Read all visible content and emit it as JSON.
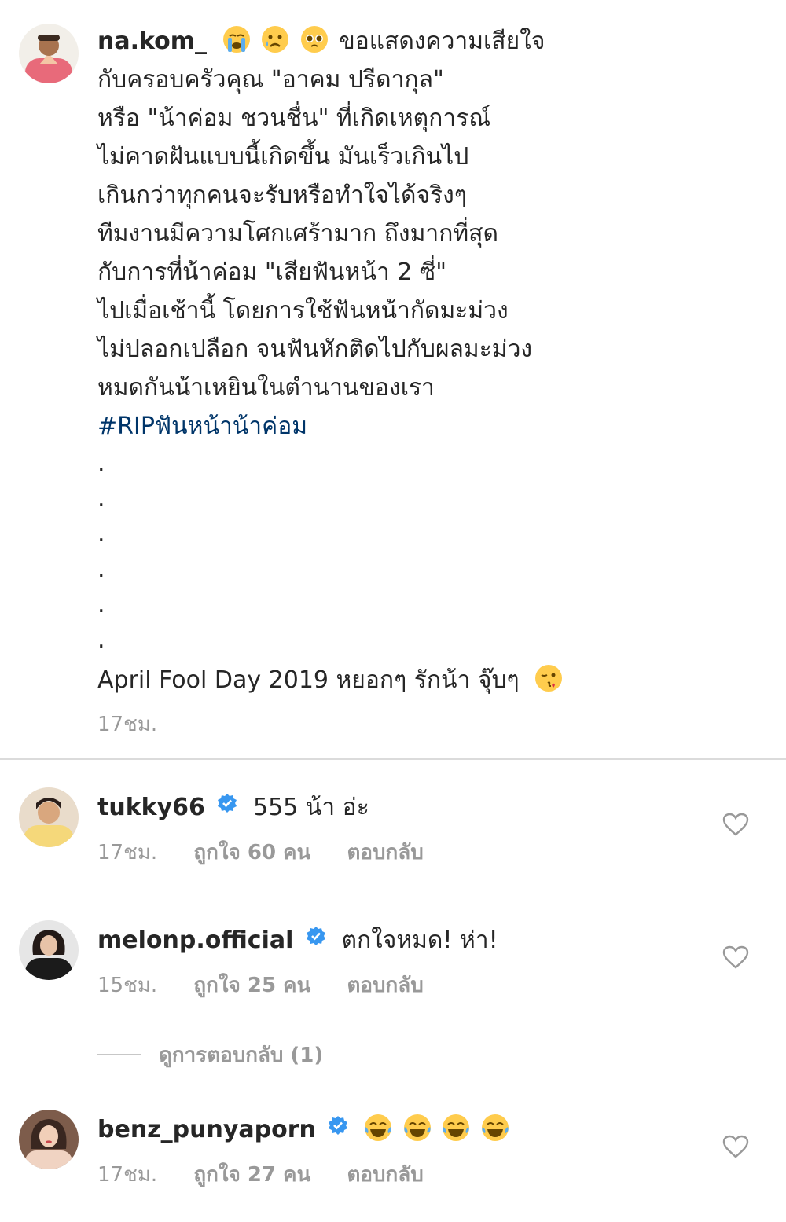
{
  "post": {
    "username": "na.kom_",
    "emojis": [
      "loudly-crying-face",
      "crying-face",
      "pleading-face"
    ],
    "lines": [
      "ขอแสดงความเสียใจ",
      "กับครอบครัวคุณ \"อาคม ปรีดากุล\"",
      "หรือ \"น้าค่อม ชวนชื่น\" ที่เกิดเหตุการณ์",
      "ไม่คาดฝันแบบนี้เกิดขึ้น มันเร็วเกินไป",
      "เกินกว่าทุกคนจะรับหรือทำใจได้จริงๆ",
      "ทีมงานมีความโศกเศร้ามาก ถึงมากที่สุด",
      "กับการที่น้าค่อม \"เสียฟันหน้า 2 ซี่\"",
      "ไปเมื่อเช้านี้ โดยการใช้ฟันหน้ากัดมะม่วง",
      "ไม่ปลอกเปลือก จนฟันหักติดไปกับผลมะม่วง",
      "หมดกันน้าเหยินในตำนานของเรา"
    ],
    "hashtag": "#RIPฟันหน้าน้าค่อม",
    "dots": [
      ".",
      ".",
      ".",
      ".",
      ".",
      "."
    ],
    "final_line": "April Fool Day 2019 หยอกๆ รักน้า จุ๊บๆ",
    "final_emoji": "face-blowing-kiss",
    "time": "17ชม."
  },
  "comments": [
    {
      "username": "tukky66",
      "verified": true,
      "text": "555 น้า อ่ะ",
      "time": "17ชม.",
      "likes": "ถูกใจ 60 คน",
      "reply": "ตอบกลับ"
    },
    {
      "username": "melonp.official",
      "verified": true,
      "text": "ตกใจหมด! ห่า!",
      "time": "15ชม.",
      "likes": "ถูกใจ 25 คน",
      "reply": "ตอบกลับ"
    },
    {
      "username": "benz_punyaporn",
      "verified": true,
      "emojis": [
        "tears-of-joy",
        "tears-of-joy",
        "tears-of-joy",
        "tears-of-joy"
      ],
      "time": "17ชม.",
      "likes": "ถูกใจ 27 คน",
      "reply": "ตอบกลับ"
    }
  ],
  "view_replies": "ดูการตอบกลับ (1)",
  "colors": {
    "text": "#262626",
    "muted": "#999999",
    "hashtag": "#003569",
    "verified": "#3897f0",
    "divider": "#dbdbdb"
  }
}
